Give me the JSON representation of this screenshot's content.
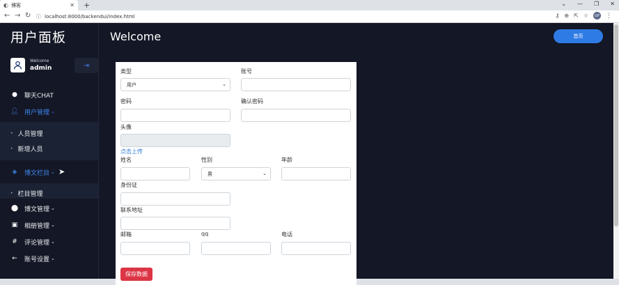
{
  "browser": {
    "tab_title": "博客",
    "url": "localhost:8000/backendui/index.html",
    "new_tab": "+",
    "profile_initials": "GP"
  },
  "sidebar": {
    "panel_title": "用户面板",
    "user": {
      "welcome": "Welcome",
      "name": "admin"
    },
    "items": [
      {
        "label": "聊天CHAT"
      },
      {
        "label": "用户管理"
      },
      {
        "label": "博文栏目"
      },
      {
        "label": "博文管理"
      },
      {
        "label": "相册管理"
      },
      {
        "label": "评论管理"
      },
      {
        "label": "账号设置"
      }
    ],
    "sub_user": [
      {
        "label": "人员管理"
      },
      {
        "label": "新增人员"
      }
    ],
    "sub_column": [
      {
        "label": "栏目管理"
      }
    ]
  },
  "main": {
    "title": "Welcome",
    "home_button": "首页"
  },
  "form": {
    "type_label": "类型",
    "type_value": "用户",
    "account_label": "账号",
    "password_label": "密码",
    "confirm_label": "确认密码",
    "avatar_label": "头像",
    "upload_link": "点击上传",
    "name_label": "姓名",
    "gender_label": "性别",
    "gender_value": "男",
    "age_label": "年龄",
    "id_label": "身份证",
    "address_label": "联系地址",
    "email_label": "邮箱",
    "qq_label": "qq",
    "phone_label": "电话",
    "save_button": "保存数据"
  },
  "colors": {
    "accent": "#2f7be5",
    "sidebar_bg": "#141725",
    "danger": "#dc3545"
  }
}
